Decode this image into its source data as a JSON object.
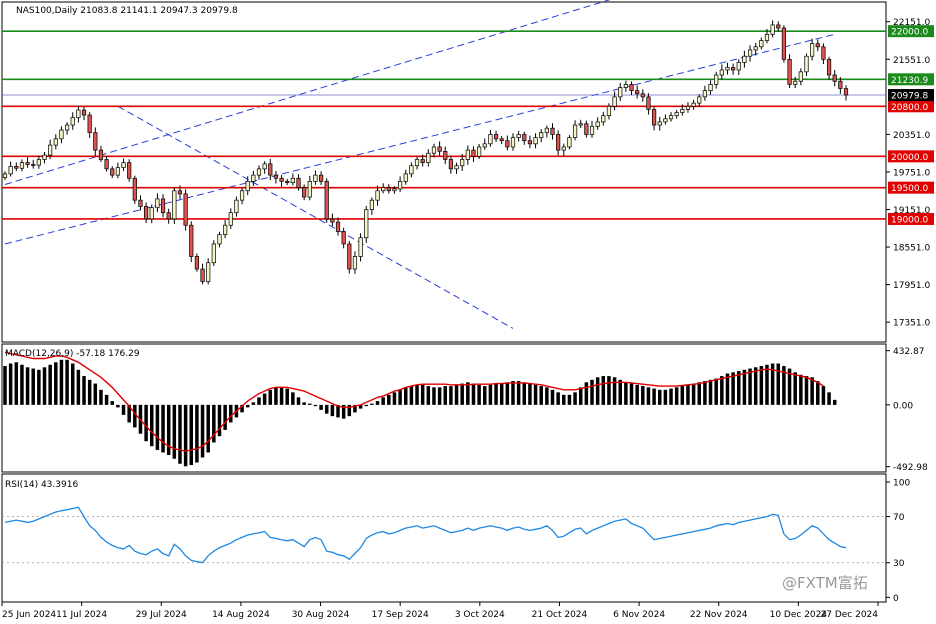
{
  "chart_data": {
    "type": "candlestick",
    "symbol_header": "NAS100,Daily  21083.8 21141.1 20947.3 20979.8",
    "watermark": "@FXTM富拓",
    "price_axis": {
      "range": [
        17050,
        22450
      ],
      "ticks": [
        "22151.0",
        "21551.0",
        "20351.0",
        "19751.0",
        "19151.0",
        "18551.0",
        "17951.0",
        "17351.0"
      ],
      "tick_values": [
        22151.0,
        21551.0,
        20351.0,
        19751.0,
        19151.0,
        18551.0,
        17951.0,
        17351.0
      ]
    },
    "horizontal_levels": [
      {
        "value": 22000.0,
        "label": "22000.0",
        "color": "#1a8a1a"
      },
      {
        "value": 21230.9,
        "label": "21230.9",
        "color": "#1a8a1a"
      },
      {
        "value": 20800.0,
        "label": "20800.0",
        "color": "#e00000"
      },
      {
        "value": 20000.0,
        "label": "20000.0",
        "color": "#e00000"
      },
      {
        "value": 19500.0,
        "label": "19500.0",
        "color": "#e00000"
      },
      {
        "value": 19000.0,
        "label": "19000.0",
        "color": "#e00000"
      }
    ],
    "current_price": {
      "value": 20979.8,
      "label": "20979.8"
    },
    "dates": [
      "25 Jun 2024",
      "11 Jul 2024",
      "29 Jul 2024",
      "14 Aug 2024",
      "30 Aug 2024",
      "17 Sep 2024",
      "3 Oct 2024",
      "21 Oct 2024",
      "6 Nov 2024",
      "22 Nov 2024",
      "10 Dec 2024",
      "27 Dec 2024"
    ],
    "closes": [
      19720,
      19840,
      19810,
      19900,
      19870,
      19860,
      19950,
      20020,
      20180,
      20280,
      20420,
      20500,
      20620,
      20740,
      20660,
      20380,
      20100,
      19950,
      19800,
      19700,
      19820,
      19900,
      19650,
      19300,
      19200,
      19000,
      19180,
      19320,
      19100,
      19000,
      19450,
      19400,
      18900,
      18400,
      18200,
      18000,
      18300,
      18600,
      18750,
      18900,
      19100,
      19300,
      19450,
      19600,
      19700,
      19800,
      19880,
      19700,
      19650,
      19600,
      19580,
      19650,
      19500,
      19350,
      19600,
      19700,
      19600,
      19000,
      18950,
      18800,
      18600,
      18200,
      18400,
      18700,
      19150,
      19300,
      19450,
      19500,
      19450,
      19480,
      19600,
      19720,
      19850,
      19950,
      19900,
      20050,
      20150,
      20080,
      19950,
      19800,
      19850,
      19950,
      20100,
      20000,
      20150,
      20200,
      20350,
      20280,
      20250,
      20150,
      20300,
      20350,
      20250,
      20200,
      20300,
      20380,
      20450,
      20350,
      20100,
      20150,
      20300,
      20500,
      20520,
      20350,
      20480,
      20550,
      20650,
      20800,
      20950,
      21100,
      21150,
      21050,
      21000,
      20950,
      20750,
      20500,
      20550,
      20600,
      20650,
      20700,
      20750,
      20800,
      20850,
      20950,
      21050,
      21150,
      21300,
      21380,
      21420,
      21380,
      21500,
      21600,
      21700,
      21750,
      21850,
      21950,
      22100,
      22050,
      21550,
      21150,
      21200,
      21350,
      21600,
      21800,
      21750,
      21550,
      21300,
      21200,
      21083,
      20980
    ],
    "macd": {
      "label": "MACD(12,26,9) -57.18 176.29",
      "range": [
        -520,
        470
      ],
      "ticks": [
        "432.87",
        "0.00",
        "-492.98"
      ],
      "tick_values": [
        432.87,
        0.0,
        -492.98
      ],
      "signal_color": "#e00000",
      "histogram": [
        310,
        330,
        340,
        320,
        300,
        290,
        280,
        300,
        320,
        340,
        360,
        360,
        330,
        280,
        230,
        200,
        170,
        120,
        80,
        30,
        -20,
        -80,
        -140,
        -180,
        -230,
        -290,
        -330,
        -360,
        -380,
        -400,
        -430,
        -470,
        -490,
        -480,
        -460,
        -420,
        -380,
        -300,
        -250,
        -200,
        -140,
        -100,
        -60,
        -20,
        20,
        60,
        90,
        120,
        140,
        140,
        130,
        100,
        60,
        20,
        10,
        -10,
        -40,
        -70,
        -90,
        -100,
        -110,
        -90,
        -60,
        -30,
        -10,
        10,
        30,
        60,
        80,
        100,
        120,
        140,
        150,
        160,
        160,
        150,
        140,
        140,
        150,
        150,
        160,
        170,
        180,
        170,
        160,
        150,
        160,
        170,
        170,
        180,
        190,
        190,
        180,
        170,
        160,
        150,
        140,
        120,
        100,
        80,
        80,
        100,
        140,
        180,
        200,
        220,
        230,
        230,
        220,
        200,
        180,
        170,
        160,
        150,
        140,
        130,
        120,
        120,
        130,
        140,
        150,
        160,
        170,
        180,
        190,
        200,
        210,
        230,
        250,
        260,
        270,
        280,
        290,
        300,
        310,
        320,
        330,
        330,
        310,
        290,
        260,
        240,
        230,
        220,
        190,
        150,
        100,
        40
      ],
      "signal": [
        420,
        410,
        400,
        390,
        380,
        370,
        370,
        370,
        380,
        390,
        390,
        380,
        360,
        340,
        310,
        280,
        250,
        220,
        180,
        140,
        90,
        40,
        -10,
        -70,
        -120,
        -170,
        -220,
        -260,
        -300,
        -330,
        -350,
        -360,
        -370,
        -360,
        -350,
        -330,
        -290,
        -240,
        -190,
        -140,
        -90,
        -50,
        -10,
        30,
        60,
        90,
        110,
        130,
        140,
        140,
        140,
        130,
        120,
        110,
        90,
        70,
        50,
        30,
        10,
        -10,
        -20,
        -20,
        -10,
        0,
        20,
        40,
        60,
        70,
        90,
        110,
        120,
        140,
        150,
        160,
        165,
        165,
        165,
        165,
        165,
        160,
        160,
        160,
        160,
        165,
        165,
        165,
        165,
        170,
        170,
        175,
        175,
        175,
        175,
        170,
        165,
        160,
        150,
        140,
        130,
        120,
        120,
        120,
        130,
        140,
        150,
        160,
        170,
        175,
        180,
        180,
        180,
        175,
        170,
        165,
        160,
        155,
        150,
        150,
        150,
        150,
        155,
        160,
        165,
        170,
        180,
        190,
        200,
        210,
        220,
        230,
        240,
        250,
        260,
        270,
        280,
        285,
        280,
        270,
        260,
        250,
        240,
        230,
        220,
        200,
        180,
        150
      ]
    },
    "rsi": {
      "label": "RSI(14) 43.3916",
      "range": [
        0,
        100
      ],
      "ticks": [
        "100",
        "70",
        "30",
        "0"
      ],
      "tick_values": [
        100,
        70,
        30,
        0
      ],
      "levels": [
        70,
        30
      ],
      "color": "#1e88e5",
      "values": [
        65,
        66,
        67,
        66,
        65,
        66,
        68,
        70,
        72,
        74,
        75,
        76,
        77,
        78,
        70,
        62,
        58,
        52,
        48,
        45,
        43,
        42,
        45,
        40,
        38,
        37,
        40,
        42,
        38,
        36,
        46,
        42,
        36,
        32,
        31,
        30,
        36,
        40,
        43,
        45,
        47,
        50,
        52,
        54,
        55,
        56,
        57,
        52,
        51,
        50,
        49,
        50,
        47,
        44,
        50,
        52,
        50,
        40,
        39,
        37,
        36,
        33,
        38,
        43,
        51,
        54,
        56,
        57,
        55,
        56,
        58,
        60,
        61,
        62,
        60,
        61,
        62,
        60,
        58,
        56,
        57,
        58,
        60,
        58,
        60,
        61,
        62,
        61,
        60,
        58,
        60,
        61,
        59,
        58,
        59,
        60,
        62,
        58,
        52,
        53,
        56,
        59,
        60,
        55,
        58,
        60,
        62,
        64,
        66,
        67,
        68,
        64,
        62,
        60,
        55,
        50,
        51,
        52,
        53,
        54,
        55,
        56,
        57,
        58,
        59,
        60,
        62,
        63,
        64,
        63,
        65,
        66,
        67,
        68,
        69,
        70,
        72,
        71,
        55,
        50,
        51,
        54,
        58,
        62,
        60,
        55,
        50,
        47,
        44,
        43
      ]
    }
  }
}
